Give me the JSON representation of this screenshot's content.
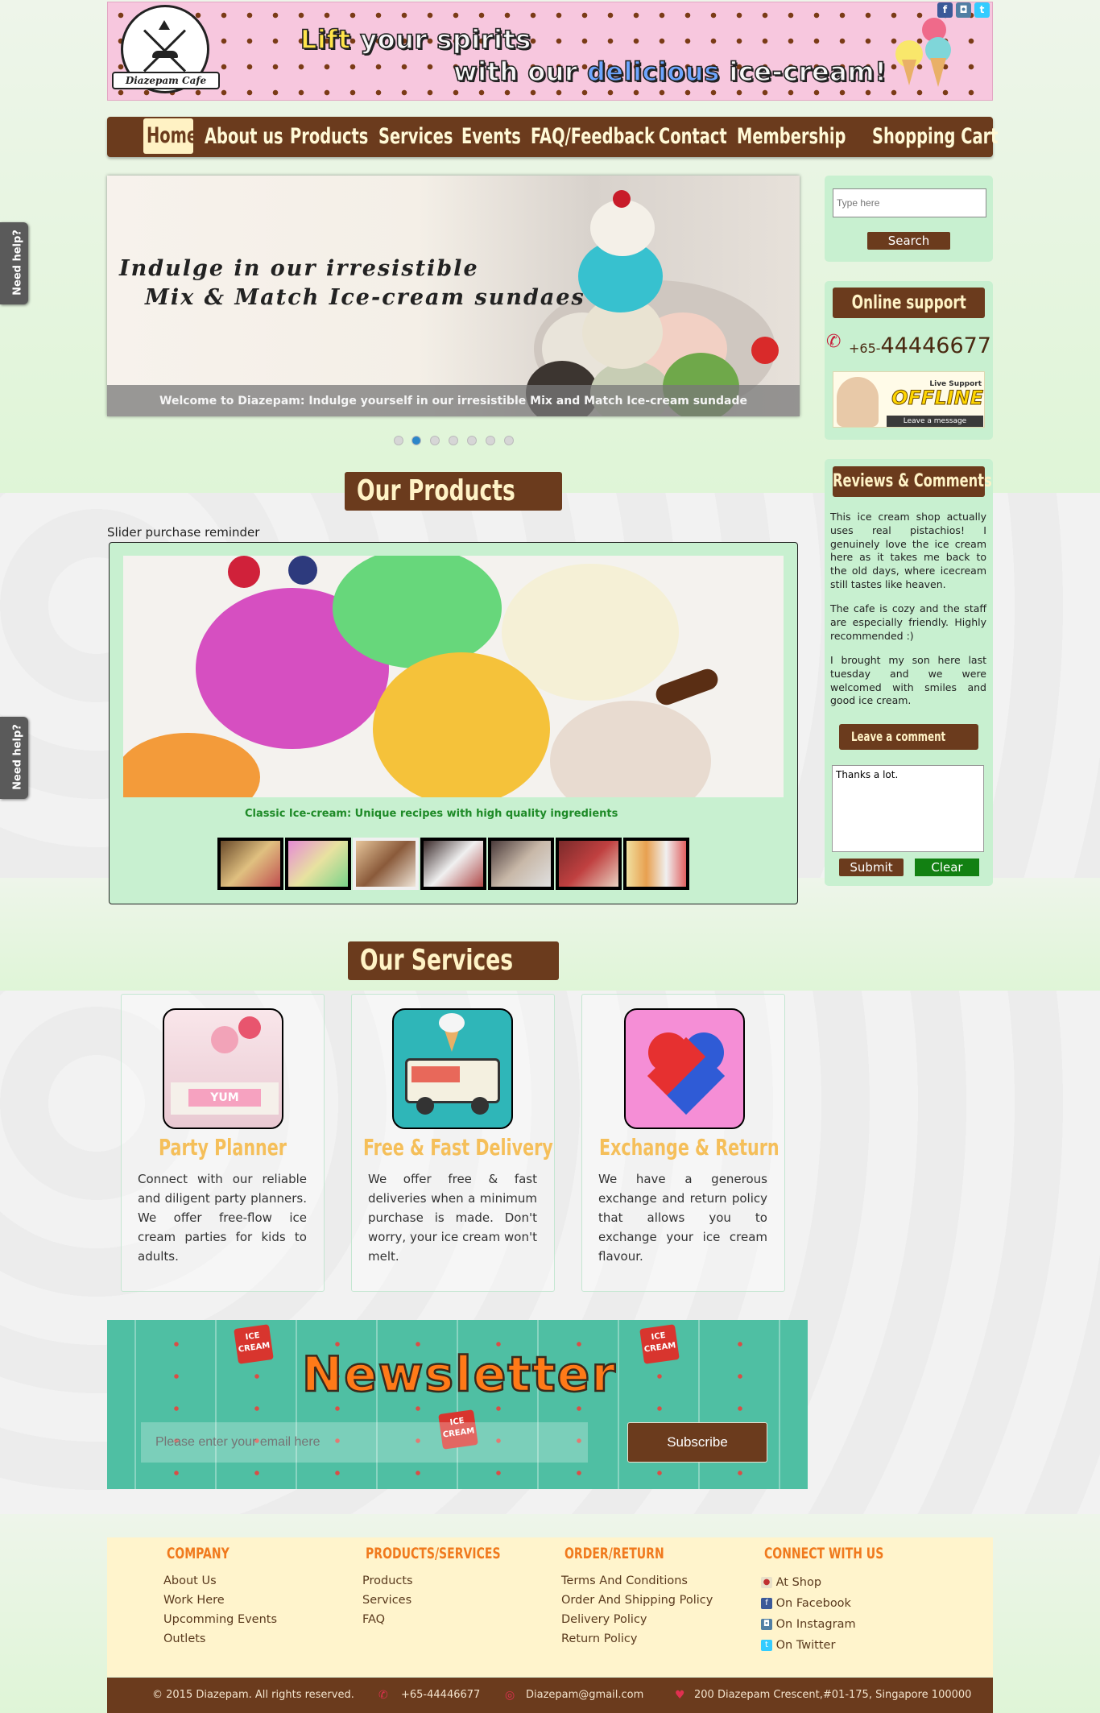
{
  "colors": {
    "brown": "#6b3b1d",
    "mint": "#c8f0d0",
    "cream": "#fff3c6",
    "orange": "#f07a1e",
    "gold": "#f5bf5a",
    "teal": "#4fbfa3",
    "pink": "#f7c7de"
  },
  "brand": {
    "logo_text": "Diazepam Cafe",
    "tagline_1a": "Lift",
    "tagline_1b": " your spirits",
    "tagline_2a": "with our ",
    "tagline_2b": "delicious",
    "tagline_2c": " ice-cream!"
  },
  "social": {
    "facebook_icon": "f",
    "instagram_icon": "◘",
    "twitter_icon": "t"
  },
  "nav": {
    "items": [
      "Home",
      "About us",
      "Products",
      "Services",
      "Events",
      "FAQ/Feedback",
      "Contact",
      "Membership",
      "Shopping Cart"
    ],
    "active": "Home"
  },
  "hero": {
    "line1": "Indulge in our irresistible",
    "line2": "Mix & Match Ice-cream sundaes",
    "caption": "Welcome to Diazepam: Indulge yourself in our irresistible Mix and Match Ice-cream sundade",
    "slide_count": 7,
    "active_slide": 2
  },
  "help_tab": {
    "label": "Need help?"
  },
  "search": {
    "placeholder": "Type here",
    "button": "Search"
  },
  "support": {
    "title": "Online support",
    "phone_prefix": "+65-",
    "phone": "44446677",
    "badge_top": "Live Support",
    "badge_main": "OFFLINE",
    "badge_bottom": "Leave a message"
  },
  "reviews": {
    "title": "Reviews & Comments",
    "items": [
      "This ice cream shop actually uses real pistachios! I genuinely love the ice cream here as it takes me back to the old days, where icecream still tastes like heaven.",
      "The cafe is cozy and the staff are especially friendly. Highly recommended :)",
      "I brought my son here last tuesday and we were welcomed with smiles and good ice cream."
    ],
    "leave_button": "Leave a comment",
    "textarea_value": "Thanks a lot.",
    "submit": "Submit",
    "clear": "Clear"
  },
  "products": {
    "title": "Our Products",
    "slider_label": "Slider purchase reminder",
    "caption": "Classic Ice-cream: Unique recipes with high quality ingredients",
    "thumbnail_count": 7
  },
  "services": {
    "title": "Our Services",
    "cards": [
      {
        "title": "Party Planner",
        "text": "Connect with our reliable and diligent party planners. We offer free-flow ice cream parties for kids to adults.",
        "banner_text": "YUM"
      },
      {
        "title": "Free & Fast Delivery",
        "text": "We offer free & fast deliveries when a minimum purchase is made. Don't worry, your ice cream won't melt."
      },
      {
        "title": "Exchange & Return",
        "text": "We have a generous exchange and return policy that allows you to exchange your ice cream flavour."
      }
    ]
  },
  "newsletter": {
    "title": "Newsletter",
    "placeholder": "Please enter your email here",
    "button": "Subscribe",
    "sticker": "ICE CREAM"
  },
  "footer": {
    "columns": [
      {
        "heading": "COMPANY",
        "links": [
          "About Us",
          "Work Here",
          "Upcomming Events",
          "Outlets"
        ]
      },
      {
        "heading": "PRODUCTS/SERVICES",
        "links": [
          "Products",
          "Services",
          "FAQ"
        ]
      },
      {
        "heading": "ORDER/RETURN",
        "links": [
          "Terms And Conditions",
          "Order And Shipping Policy",
          "Delivery Policy",
          "Return Policy"
        ]
      },
      {
        "heading": "CONNECT WITH US",
        "links": [
          "At Shop",
          "On Facebook",
          "On Instagram",
          "On Twitter"
        ]
      }
    ],
    "copyright": "© 2015 Diazepam. All rights reserved.",
    "phone": "+65-44446677",
    "email": "Diazepam@gmail.com",
    "address": "200 Diazepam Crescent,#01-175, Singapore 100000"
  }
}
